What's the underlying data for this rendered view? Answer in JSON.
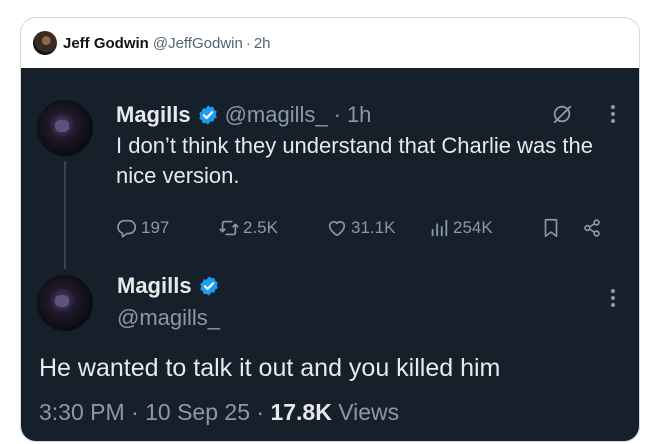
{
  "quoter": {
    "name": "Jeff Godwin",
    "handle": "@JeffGodwin",
    "separator": "·",
    "time": "2h"
  },
  "tweet1": {
    "name": "Magills",
    "handle": "@magills_",
    "separator": "·",
    "time": "1h",
    "text": "I don’t think they understand that Charlie was the nice version.",
    "stats": {
      "replies": "197",
      "reposts": "2.5K",
      "likes": "31.1K",
      "views": "254K"
    }
  },
  "tweet2": {
    "name": "Magills",
    "handle": "@magills_",
    "text": "He wanted to talk it out and you killed him",
    "time": "3:30 PM",
    "date": "10 Sep 25",
    "separator": "·",
    "views_count": "17.8K",
    "views_label": "Views"
  },
  "colors": {
    "dark_bg": "#15202b",
    "verified": "#1d9bf0",
    "text_primary": "#e7e9ea",
    "text_secondary": "#8b98a5"
  },
  "icons": [
    "verified-badge-icon",
    "grok-icon",
    "more-icon",
    "reply-icon",
    "repost-icon",
    "like-icon",
    "views-icon",
    "bookmark-icon",
    "share-icon"
  ]
}
